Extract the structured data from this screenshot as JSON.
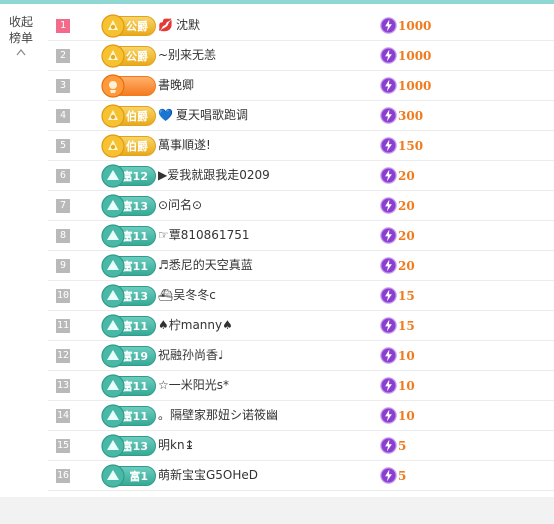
{
  "collapse_label": "收起榜单",
  "colors": {
    "accent_border": "#8fd7d3",
    "score": "#f07a1c",
    "gold": "#e9a91a",
    "teal": "#37a996",
    "orange": "#f57a22"
  },
  "rows": [
    {
      "rank": "1",
      "badge": "公爵",
      "badge_type": "gold",
      "deco": "💋",
      "name": "沈默",
      "score": "1000"
    },
    {
      "rank": "2",
      "badge": "公爵",
      "badge_type": "gold",
      "deco": "",
      "name": "~别来无恙",
      "score": "1000"
    },
    {
      "rank": "3",
      "badge": "",
      "badge_type": "orange",
      "deco": "",
      "name": "書晚卿",
      "score": "1000"
    },
    {
      "rank": "4",
      "badge": "伯爵",
      "badge_type": "gold",
      "deco": "💙",
      "name": "夏天唱歌跑调",
      "score": "300"
    },
    {
      "rank": "5",
      "badge": "伯爵",
      "badge_type": "gold",
      "deco": "",
      "name": "萬事順遂!",
      "score": "150"
    },
    {
      "rank": "6",
      "badge": "富12",
      "badge_type": "teal",
      "deco": "",
      "name": "▶爱我就跟我走0209",
      "score": "20"
    },
    {
      "rank": "7",
      "badge": "富13",
      "badge_type": "teal",
      "deco": "",
      "name": "⊙问名⊙",
      "score": "20"
    },
    {
      "rank": "8",
      "badge": "富11",
      "badge_type": "teal",
      "deco": "",
      "name": "☞覃810861751",
      "score": "20"
    },
    {
      "rank": "9",
      "badge": "富11",
      "badge_type": "teal",
      "deco": "",
      "name": "♬悉尼的天空真蓝",
      "score": "20"
    },
    {
      "rank": "10",
      "badge": "富13",
      "badge_type": "teal",
      "deco": "",
      "name": "⛴吴冬冬c",
      "score": "15"
    },
    {
      "rank": "11",
      "badge": "富11",
      "badge_type": "teal",
      "deco": "",
      "name": "♠柠manny♠",
      "score": "15"
    },
    {
      "rank": "12",
      "badge": "富19",
      "badge_type": "teal",
      "deco": "",
      "name": "祝融孙尚香♩",
      "score": "10"
    },
    {
      "rank": "13",
      "badge": "富11",
      "badge_type": "teal",
      "deco": "",
      "name": "☆一米阳光s*",
      "score": "10"
    },
    {
      "rank": "14",
      "badge": "富11",
      "badge_type": "teal",
      "deco": "",
      "name": "。隔壁家那妞シ诺筱幽",
      "score": "10"
    },
    {
      "rank": "15",
      "badge": "富13",
      "badge_type": "teal",
      "deco": "",
      "name": "明kn↨",
      "score": "5"
    },
    {
      "rank": "16",
      "badge": "富1",
      "badge_type": "teal",
      "deco": "",
      "name": "萌新宝宝G5OHeD",
      "score": "5"
    }
  ]
}
